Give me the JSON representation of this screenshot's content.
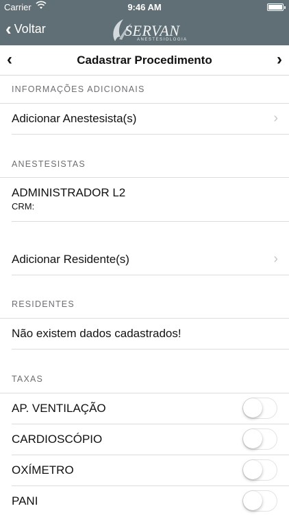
{
  "status_bar": {
    "carrier": "Carrier",
    "time": "9:46 AM",
    "wifi_icon": "wifi-icon",
    "battery_level": 1.0
  },
  "nav": {
    "back_label": "Voltar",
    "logo_name": "SERVAN",
    "logo_sub": "ANESTESIOLOGIA"
  },
  "header": {
    "title": "Cadastrar Procedimento"
  },
  "sections": {
    "info": "INFORMAÇÕES ADICIONAIS",
    "anestesistas": "ANESTESISTAS",
    "residentes": "RESIDENTES",
    "taxas": "TAXAS"
  },
  "rows": {
    "add_anestesista": "Adicionar Anestesista(s)",
    "anestesista_name": "ADMINISTRADOR L2",
    "anestesista_crm": "CRM:",
    "add_residente": "Adicionar Residente(s)",
    "no_data": "Não existem dados cadastrados!"
  },
  "taxas": [
    {
      "label": "AP. VENTILAÇÃO",
      "on": false
    },
    {
      "label": "CARDIOSCÓPIO",
      "on": false
    },
    {
      "label": "OXÍMETRO",
      "on": false
    },
    {
      "label": "PANI",
      "on": false
    }
  ],
  "colors": {
    "nav_bg": "#5f6f75",
    "text": "#111111",
    "section_text": "#6d6d72"
  }
}
